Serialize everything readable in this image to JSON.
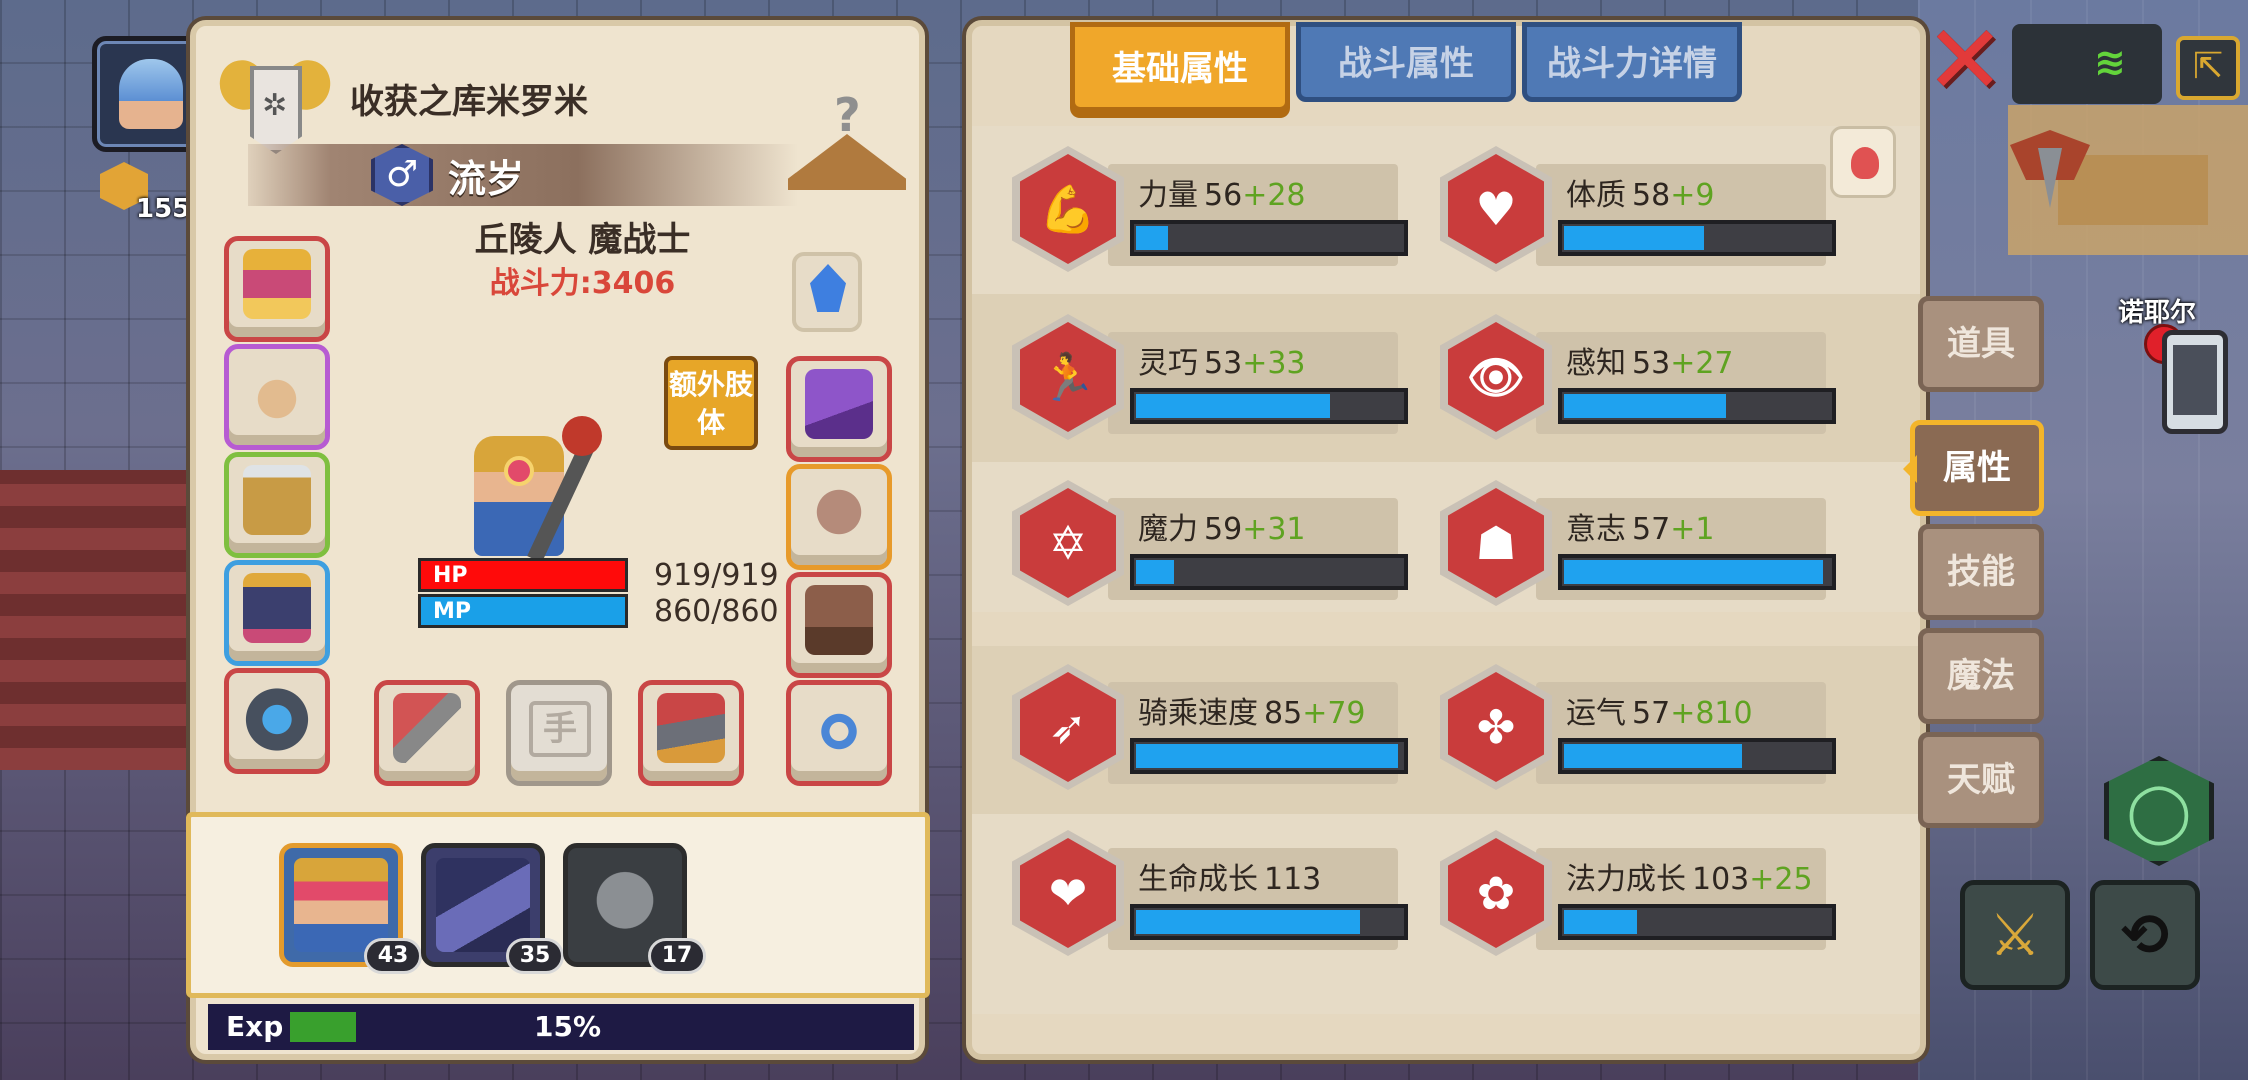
{
  "hud": {
    "coin_count": "155",
    "npc_label": "诺耶尔",
    "icons": [
      "close-icon",
      "wifi-icon",
      "exit-icon",
      "sword-icon",
      "bow-icon",
      "hexagon-skill-icon",
      "phone-icon"
    ]
  },
  "character": {
    "title": "收获之库米罗米",
    "gender_icon": "♂",
    "name": "流岁",
    "race_class": "丘陵人 魔战士",
    "power": "战斗力:3406",
    "extra_limb_label": "额外肢体",
    "hand_slot_glyph": "手",
    "hp_label": "HP",
    "hp_value": "919/919",
    "hp_fill": 1.0,
    "mp_label": "MP",
    "mp_value": "860/860",
    "mp_fill": 1.0,
    "exp_label": "Exp",
    "exp_percent": "15%",
    "exp_fill": 0.15,
    "colors": {
      "hp": "#ff0a0a",
      "mp": "#1aa0e8",
      "exp": "#39a02d",
      "power": "#d9473a"
    }
  },
  "team": [
    {
      "level": "43",
      "active": true
    },
    {
      "level": "35",
      "active": false
    },
    {
      "level": "17",
      "active": false
    }
  ],
  "tabs": [
    "基础属性",
    "战斗属性",
    "战斗力详情"
  ],
  "stats": [
    {
      "icon": "muscle-icon",
      "glyph": "💪",
      "name": "力量",
      "base": "56",
      "bonus": "+28",
      "fill": 0.12
    },
    {
      "icon": "constitution-icon",
      "glyph": "♥",
      "name": "体质",
      "base": "58",
      "bonus": "+9",
      "fill": 0.52
    },
    {
      "icon": "agility-icon",
      "glyph": "🏃",
      "name": "灵巧",
      "base": "53",
      "bonus": "+33",
      "fill": 0.72
    },
    {
      "icon": "perception-eye-icon",
      "glyph": "👁",
      "name": "感知",
      "base": "53",
      "bonus": "+27",
      "fill": 0.6
    },
    {
      "icon": "magic-star-icon",
      "glyph": "✡",
      "name": "魔力",
      "base": "59",
      "bonus": "+31",
      "fill": 0.14
    },
    {
      "icon": "will-head-icon",
      "glyph": "☗",
      "name": "意志",
      "base": "57",
      "bonus": "+1",
      "fill": 0.96
    },
    {
      "icon": "riding-speed-icon",
      "glyph": "➶",
      "name": "骑乘速度",
      "base": "85",
      "bonus": "+79",
      "fill": 0.97
    },
    {
      "icon": "luck-clover-icon",
      "glyph": "✤",
      "name": "运气",
      "base": "57",
      "bonus": "+810",
      "fill": 0.66
    },
    {
      "icon": "life-growth-icon",
      "glyph": "❤",
      "name": "生命成长",
      "base": "113",
      "bonus": "",
      "fill": 0.83
    },
    {
      "icon": "mana-growth-icon",
      "glyph": "✿",
      "name": "法力成长",
      "base": "103",
      "bonus": "+25",
      "fill": 0.27
    }
  ],
  "side_menu": [
    "道具",
    "属性",
    "技能",
    "魔法",
    "天赋"
  ],
  "side_menu_active": 1
}
